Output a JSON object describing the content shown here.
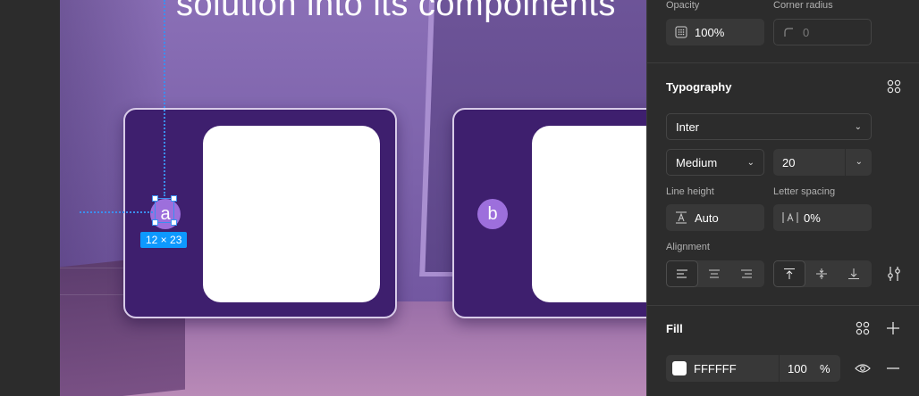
{
  "canvas": {
    "heading": "solution into its compoinents",
    "card_a_letter": "a",
    "card_b_letter": "b",
    "selection_size": "12 × 23"
  },
  "layer": {
    "opacity_label": "Opacity",
    "opacity_value": "100%",
    "radius_label": "Corner radius",
    "radius_value": "0"
  },
  "typography": {
    "title": "Typography",
    "font_family": "Inter",
    "font_weight": "Medium",
    "font_size": "20",
    "line_height_label": "Line height",
    "line_height_value": "Auto",
    "letter_spacing_label": "Letter spacing",
    "letter_spacing_value": "0%",
    "alignment_label": "Alignment"
  },
  "fill": {
    "title": "Fill",
    "hex": "FFFFFF",
    "opacity": "100",
    "percent": "%",
    "color": "#ffffff"
  }
}
